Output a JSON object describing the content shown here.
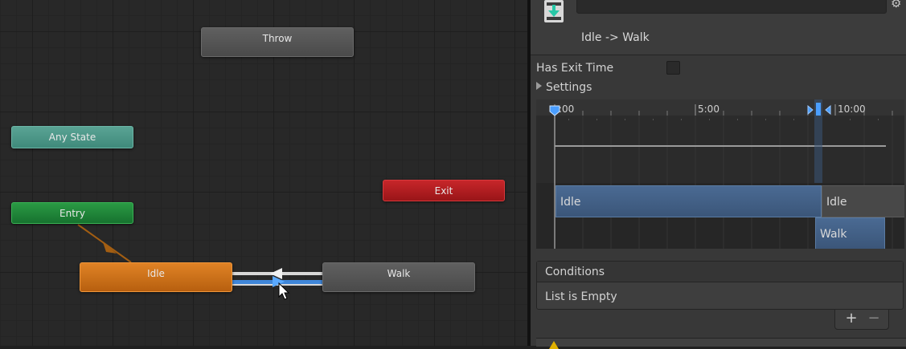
{
  "graph": {
    "states": {
      "throw": "Throw",
      "any_state": "Any State",
      "entry": "Entry",
      "exit": "Exit",
      "idle": "Idle",
      "walk": "Walk"
    }
  },
  "inspector": {
    "transition_name_value": "",
    "transition_title": "Idle -> Walk",
    "has_exit_time_label": "Has Exit Time",
    "has_exit_time_checked": false,
    "settings_label": "Settings",
    "timeline": {
      "ruler_labels": [
        ":00",
        "5:00",
        "10:00"
      ],
      "bars": {
        "source_state": "Idle",
        "source_state_next": "Idle",
        "destination_state": "Walk"
      }
    },
    "conditions": {
      "header": "Conditions",
      "empty_text": "List is Empty",
      "add_symbol": "+",
      "remove_symbol": "−"
    }
  },
  "colors": {
    "idle_state": "#e08325",
    "entry_state": "#2a9a44",
    "any_state": "#5aa394",
    "exit_state": "#c7262a",
    "default_state": "#555555",
    "selected_transition": "#4a9eff",
    "timeline_bar": "#4a6a93"
  },
  "icons": {
    "transition": "transition-icon",
    "settings": "gear-icon",
    "cursor": "mouse-cursor-icon"
  }
}
